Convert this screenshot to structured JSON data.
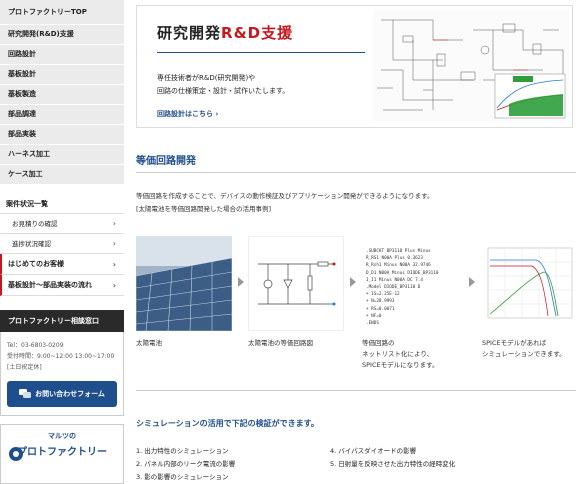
{
  "sidebar": {
    "nav": [
      "プロトファクトリーTOP",
      "研究開発(R&D)支援",
      "回路設計",
      "基板設計",
      "基板製造",
      "部品調達",
      "部品実装",
      "ハーネス加工",
      "ケース加工"
    ],
    "case_head": "案件状況一覧",
    "case_items": [
      "お見積りの確認",
      "進捗状況確認"
    ],
    "guide_items": [
      "はじめてのお客様",
      "基板設計～部品実装の流れ"
    ],
    "contact_title": "プロトファクトリー相談窓口",
    "tel": "Tel：03-6803-0209",
    "hours": "受付時間：9:00~12:00 13:00~17:00",
    "holiday": "[土日祝定休]",
    "inquiry_button": "お問い合わせフォーム",
    "logo_small": "マルツの",
    "logo_big": "プロトファクトリー"
  },
  "banner": {
    "title_main": "研究開発",
    "title_accent": "R&D支援",
    "desc_line1": "専任技術者がR&D(研究開発)や",
    "desc_line2": "回路の仕様策定・設計・試作いたします。",
    "link": "回路設計はこちら",
    "link_chevron": "›"
  },
  "section1": {
    "heading": "等価回路開発",
    "intro": "等価回路を作成することで、デバイスの動作検証及びアプリケーション開発ができるようになります。",
    "example": "[太陽電池を等価回路開発した場合の活用事例]",
    "steps": [
      {
        "caption1": "太陽電池",
        "caption2": ""
      },
      {
        "caption1": "太陽電池の等価回路図",
        "caption2": ""
      },
      {
        "caption1": "等価回路の",
        "caption2": "ネットリスト化により、",
        "caption3": "SPICEモデルになります。"
      },
      {
        "caption1": "SPICEモデルがあれば",
        "caption2": "シミュレーションできます。"
      }
    ],
    "netlist": [
      ".SUBCKT BP3110 Plus Minus",
      "R_RS1 N00A Plus 0.3623",
      "R_Rsh1 Minus N00A 32.9746",
      "D_D1 N00A Minus DIODE_BP3110",
      "I_I1 Minus N00A DC 7.4",
      ".Model DIODE_BP3110 D",
      "+ IS=2.25E-12",
      "+ N=28.9993",
      "+ RS=0.0071",
      "+ NF=0",
      ".ENDS"
    ]
  },
  "section2": {
    "heading": "シミュレーションの活用で下記の検証ができます。",
    "items_left": [
      "1. 出力特性のシミュレーション",
      "2. パネル内部のリーク電流の影響",
      "3. 影の影響のシミュレーション"
    ],
    "items_right": [
      "4. バイパスダイオードの影響",
      "5. 日射量を反映させた出力特性の経時変化"
    ]
  },
  "colors": {
    "accent": "#1f4e8c",
    "brand_red": "#c8161d",
    "nav_bg": "#ebebeb"
  }
}
